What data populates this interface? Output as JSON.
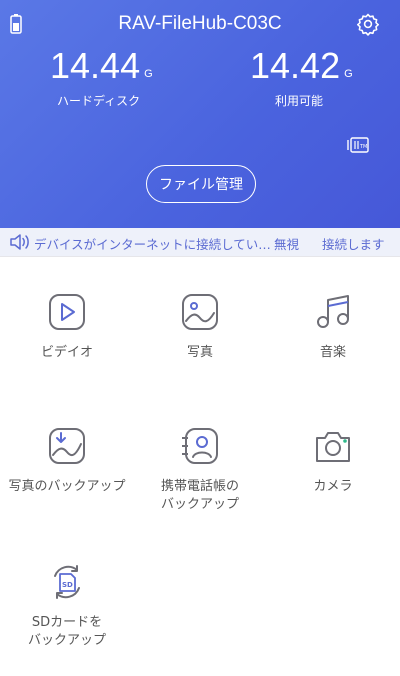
{
  "header": {
    "device_name": "RAV-FileHub-C03C",
    "disk": {
      "value": "14.44",
      "unit": "G",
      "label": "ハードディスク"
    },
    "available": {
      "value": "14.42",
      "unit": "G",
      "label": "利用可能"
    },
    "file_button": "ファイル管理"
  },
  "notice": {
    "text": "デバイスがインターネットに接続してい…",
    "ignore": "無視",
    "connect": "接続します"
  },
  "tiles": [
    {
      "label": "ビデイオ",
      "icon": "play-icon"
    },
    {
      "label": "写真",
      "icon": "photo-icon"
    },
    {
      "label": "音楽",
      "icon": "music-icon"
    },
    {
      "label": "写真のバックアップ",
      "icon": "photo-backup-icon"
    },
    {
      "label_line1": "携帯電話帳の",
      "label_line2": "バックアップ",
      "icon": "contact-backup-icon"
    },
    {
      "label": "カメラ",
      "icon": "camera-icon"
    },
    {
      "label_line1": "SDカードを",
      "label_line2": "バックアップ",
      "icon": "sd-backup-icon"
    }
  ],
  "colors": {
    "header": "#4a63de",
    "accent": "#5b6bd2",
    "icon": "#6e6e76",
    "notice_bg": "#eef1fa"
  }
}
